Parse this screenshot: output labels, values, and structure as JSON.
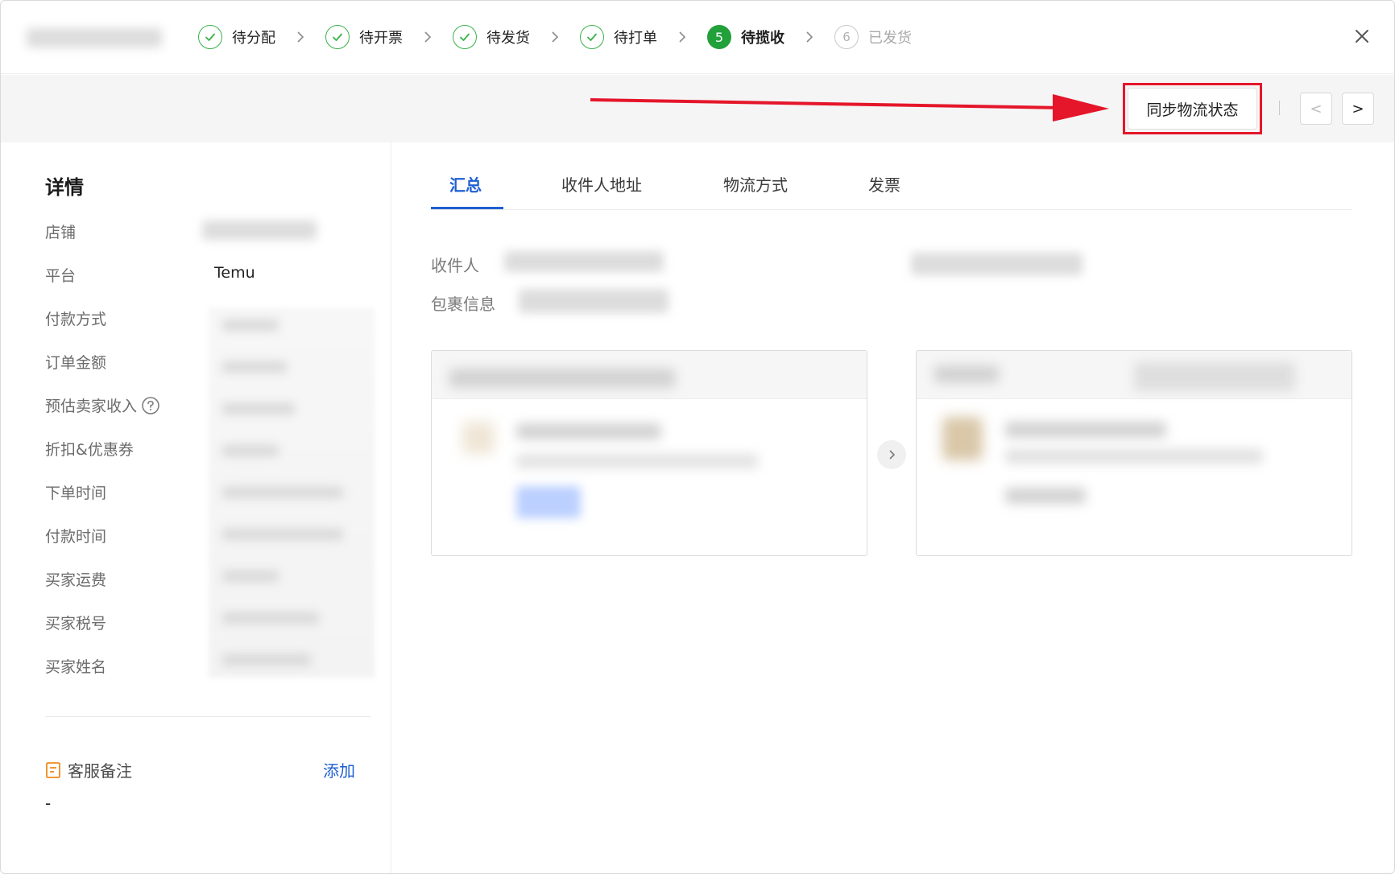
{
  "steps": [
    {
      "label": "待分配",
      "state": "done",
      "icon": "check-icon"
    },
    {
      "label": "待开票",
      "state": "done",
      "icon": "check-icon"
    },
    {
      "label": "待发货",
      "state": "done",
      "icon": "check-icon"
    },
    {
      "label": "待打单",
      "state": "done",
      "icon": "check-icon"
    },
    {
      "label": "待揽收",
      "state": "active",
      "number": "5"
    },
    {
      "label": "已发货",
      "state": "pending",
      "number": "6"
    }
  ],
  "actions": {
    "sync_label": "同步物流状态",
    "prev_label": "<",
    "next_label": ">"
  },
  "detail": {
    "title": "详情",
    "fields": [
      {
        "label": "店铺"
      },
      {
        "label": "平台",
        "value": "Temu"
      },
      {
        "label": "付款方式"
      },
      {
        "label": "订单金额"
      },
      {
        "label": "预估卖家收入"
      },
      {
        "label": "折扣&优惠券"
      },
      {
        "label": "下单时间"
      },
      {
        "label": "付款时间"
      },
      {
        "label": "买家运费"
      },
      {
        "label": "买家税号"
      },
      {
        "label": "买家姓名"
      }
    ],
    "memo": {
      "label": "客服备注",
      "add_label": "添加",
      "value": "-"
    }
  },
  "tabs": [
    {
      "label": "汇总",
      "active": true
    },
    {
      "label": "收件人地址",
      "active": false
    },
    {
      "label": "物流方式",
      "active": false
    },
    {
      "label": "发票",
      "active": false
    }
  ],
  "summary": {
    "recipient_label": "收件人",
    "package_label": "包裹信息"
  },
  "colors": {
    "accent": "#1f5fd1",
    "success": "#22a03a",
    "highlight": "#e5162a"
  }
}
